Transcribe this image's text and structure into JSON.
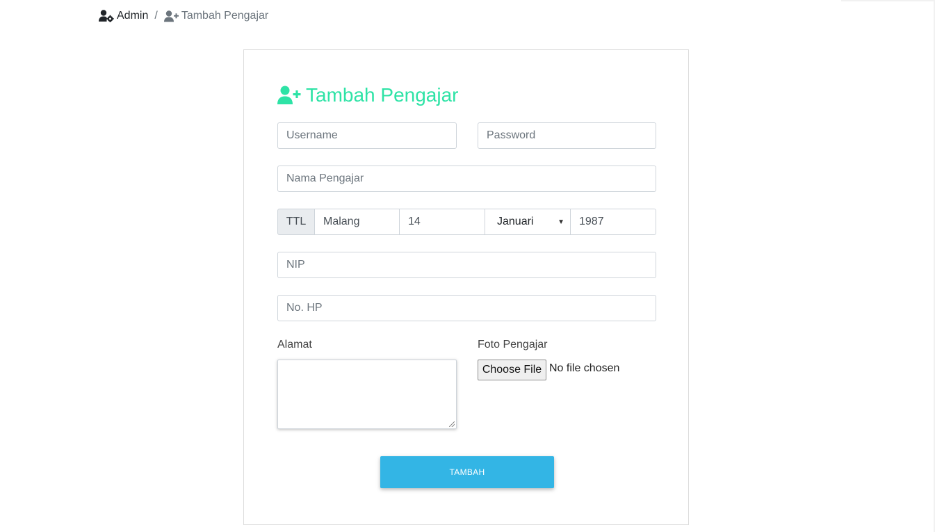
{
  "breadcrumb": {
    "items": [
      {
        "label": "Admin",
        "icon": "user-cog-icon"
      },
      {
        "label": "Tambah Pengajar",
        "icon": "user-plus-icon"
      }
    ],
    "separator": "/"
  },
  "form": {
    "title": "Tambah Pengajar",
    "title_icon": "user-plus-icon",
    "accent_color": "#2ee3a6",
    "username": {
      "placeholder": "Username",
      "value": ""
    },
    "password": {
      "placeholder": "Password",
      "value": ""
    },
    "nama": {
      "placeholder": "Nama Pengajar",
      "value": ""
    },
    "ttl": {
      "addon": "TTL",
      "tempat": "Malang",
      "tanggal": "14",
      "bulan": "Januari",
      "tahun": "1987"
    },
    "nip": {
      "placeholder": "NIP",
      "value": ""
    },
    "hp": {
      "placeholder": "No. HP",
      "value": ""
    },
    "alamat_label": "Alamat",
    "foto_label": "Foto Pengajar",
    "file_button": "Choose File",
    "file_status": "No file chosen",
    "submit_label": "TAMBAH",
    "submit_color": "#33b5e5"
  }
}
